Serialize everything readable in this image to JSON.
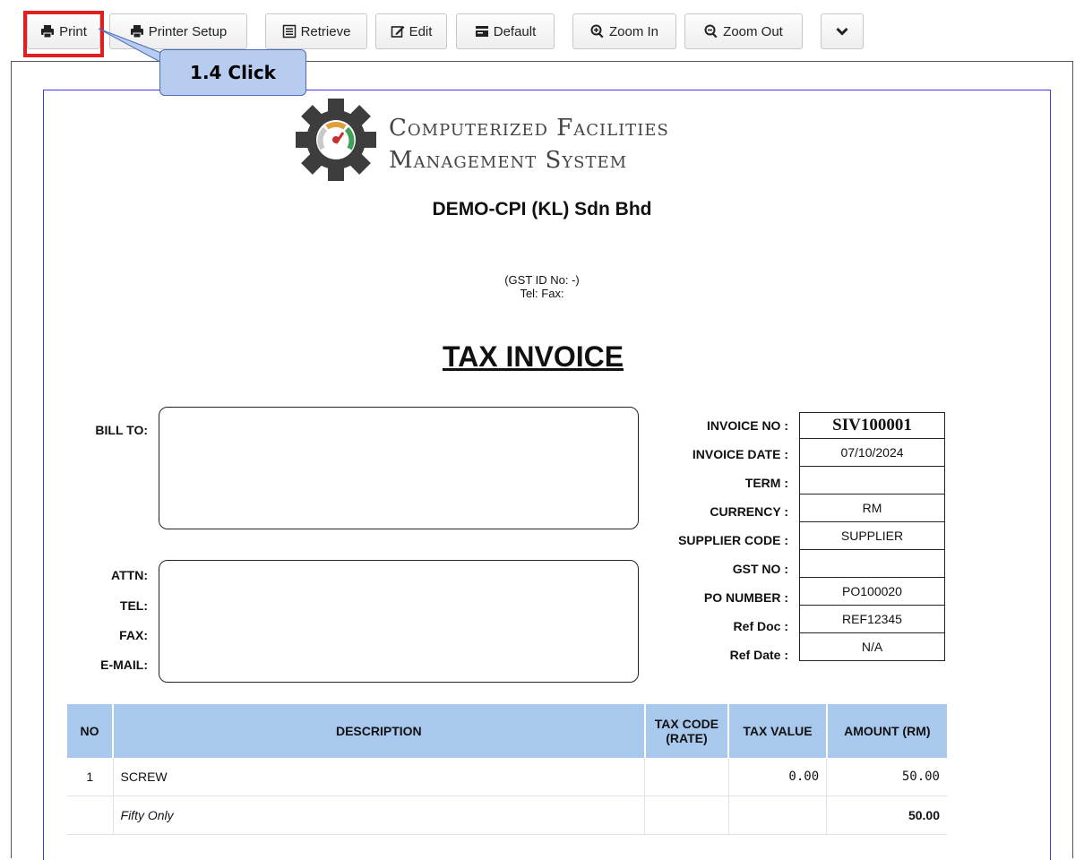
{
  "toolbar": {
    "print": "Print",
    "printer_setup": "Printer Setup",
    "retrieve": "Retrieve",
    "edit": "Edit",
    "default": "Default",
    "zoom_in": "Zoom In",
    "zoom_out": "Zoom Out"
  },
  "callout": {
    "text": "1.4 Click"
  },
  "header": {
    "brand_line1": "Computerized Facilities",
    "brand_line2": "Management System",
    "company": "DEMO-CPI (KL) Sdn Bhd",
    "gst": "(GST ID No: -)",
    "telfax": "Tel:   Fax:",
    "title": "TAX INVOICE"
  },
  "bill_to": {
    "bill_to_label": "BILL TO:",
    "attn_label": "ATTN:",
    "tel_label": "TEL:",
    "fax_label": "FAX:",
    "email_label": "E-MAIL:"
  },
  "meta": {
    "rows": [
      {
        "label": "INVOICE NO :",
        "value": "SIV100001"
      },
      {
        "label": "INVOICE DATE :",
        "value": "07/10/2024"
      },
      {
        "label": "TERM :",
        "value": ""
      },
      {
        "label": "CURRENCY :",
        "value": "RM"
      },
      {
        "label": "SUPPLIER CODE :",
        "value": "SUPPLIER"
      },
      {
        "label": "GST NO :",
        "value": ""
      },
      {
        "label": "PO NUMBER :",
        "value": "PO100020"
      },
      {
        "label": "Ref Doc :",
        "value": "REF12345"
      },
      {
        "label": "Ref Date :",
        "value": "N/A"
      }
    ]
  },
  "items": {
    "headers": [
      "NO",
      "DESCRIPTION",
      "TAX CODE (RATE)",
      "TAX VALUE",
      "AMOUNT (RM)"
    ],
    "rows": [
      {
        "no": "1",
        "description": "SCREW",
        "tax_code": "",
        "tax_value": "0.00",
        "amount": "50.00"
      }
    ],
    "total_words": "Fifty Only",
    "total_amount": "50.00"
  }
}
